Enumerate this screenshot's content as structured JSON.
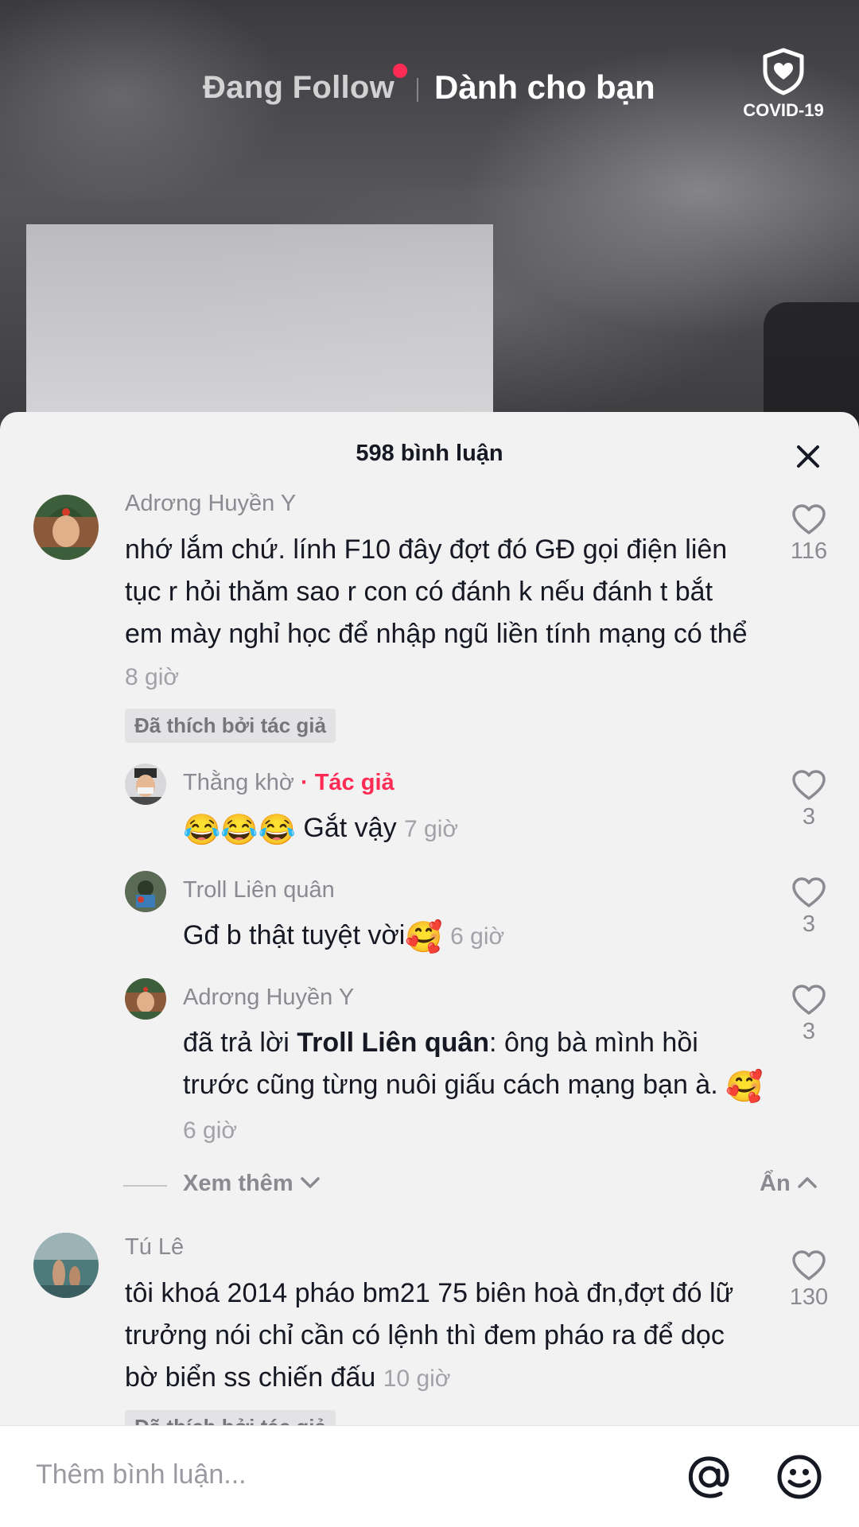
{
  "top_nav": {
    "following": "Đang Follow",
    "for_you": "Dành cho bạn",
    "covid_label": "COVID-19"
  },
  "comments_sheet": {
    "title": "598 bình luận",
    "comments": [
      {
        "username": "Adrơng Huyền Y",
        "text": "nhớ lắm chứ. lính F10 đây đợt đó GĐ gọi điện liên tục r hỏi thăm sao r con có đánh k nếu đánh t bắt em mày nghỉ học để nhập ngũ liền tính mạng có thể",
        "time": "8 giờ",
        "liked_by_author": "Đã thích bởi tác giả",
        "likes": "116"
      },
      {
        "username": "Thằng khờ",
        "author_tag": "· Tác giả",
        "emojis": "😂😂😂",
        "text": "Gắt vậy",
        "time": "7 giờ",
        "likes": "3"
      },
      {
        "username": "Troll Liên quân",
        "text": "Gđ b thật tuyệt vời",
        "emoji": "🥰",
        "time": "6 giờ",
        "likes": "3"
      },
      {
        "username": "Adrơng Huyền Y",
        "reply_prefix": "đã trả lời ",
        "reply_to": "Troll Liên quân",
        "text": ": ông bà mình hồi trước cũng từng nuôi giấu cách mạng bạn à.",
        "emoji": "🥰",
        "time": "6 giờ",
        "likes": "3"
      },
      {
        "username": "Tú Lê",
        "text": "tôi khoá 2014 pháo bm21 75 biên hoà đn,đợt đó lữ trưởng nói chỉ cần có lệnh thì đem pháo ra để dọc bờ biển ss chiến đấu",
        "time": "10 giờ",
        "liked_by_author": "Đã thích bởi tác giả",
        "likes": "130"
      }
    ],
    "see_more": "Xem thêm",
    "hide": "Ẩn"
  },
  "input_bar": {
    "placeholder": "Thêm bình luận..."
  }
}
